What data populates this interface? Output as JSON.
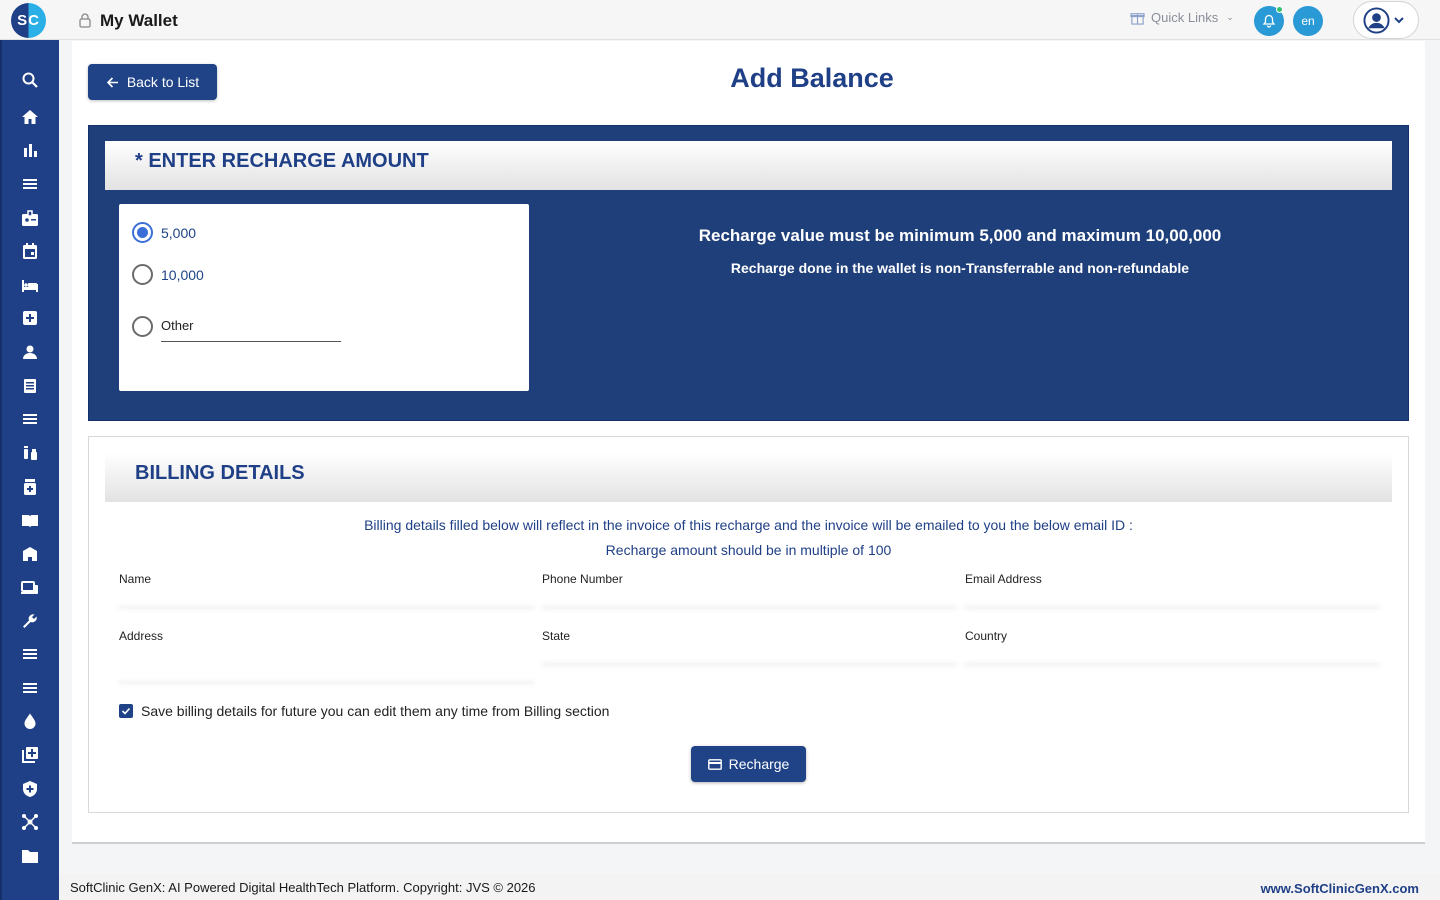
{
  "header": {
    "logo_text": "SC",
    "title": "My Wallet",
    "quick_links_label": "Quick Links",
    "language": "en"
  },
  "page": {
    "back_label": "Back to List",
    "title": "Add Balance"
  },
  "recharge": {
    "section_title": "* ENTER RECHARGE AMOUNT",
    "options": [
      {
        "label": "5,000",
        "selected": true
      },
      {
        "label": "10,000",
        "selected": false
      }
    ],
    "other_label": "Other",
    "other_value": "",
    "info_line1": "Recharge value must be minimum 5,000 and maximum 10,00,000",
    "info_line2": "Recharge done in the wallet is non-Transferrable and non-refundable"
  },
  "billing": {
    "section_title": "BILLING DETAILS",
    "note1": "Billing details filled below will reflect in the invoice of this recharge and the invoice will be emailed to you the below email ID :",
    "note2": "Recharge amount should be in multiple of 100",
    "fields": {
      "name": {
        "label": "Name",
        "value": ""
      },
      "phone": {
        "label": "Phone Number",
        "value": ""
      },
      "email": {
        "label": "Email Address",
        "value": ""
      },
      "address": {
        "label": "Address",
        "value": ""
      },
      "state": {
        "label": "State",
        "value": ""
      },
      "country": {
        "label": "Country",
        "value": ""
      }
    },
    "save_checkbox_label": "Save billing details for future you can edit them any time from Billing section",
    "save_checked": true,
    "recharge_button": "Recharge"
  },
  "footer": {
    "copyright": "SoftClinic GenX: AI Powered Digital HealthTech Platform. Copyright: JVS © 2026",
    "website": "www.SoftClinicGenX.com"
  },
  "sidebar_icons": [
    "search-icon",
    "home-icon",
    "bar-chart-icon",
    "menu-icon",
    "badge-icon",
    "calendar-icon",
    "bed-icon",
    "medical-plus-icon",
    "person-icon",
    "document-icon",
    "menu-icon",
    "vaccine-icon",
    "medicine-icon",
    "book-icon",
    "building-icon",
    "devices-icon",
    "wrench-icon",
    "menu-icon",
    "menu-icon",
    "drop-icon",
    "add-library-icon",
    "shield-icon",
    "network-icon",
    "folder-icon"
  ],
  "colors": {
    "primary": "#1f3f86",
    "panel": "#1f3f7a",
    "accent": "#2a9ad6"
  }
}
